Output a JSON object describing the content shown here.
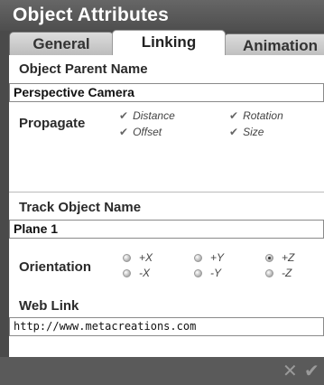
{
  "window": {
    "title": "Object Attributes"
  },
  "tabs": [
    {
      "label": "General",
      "active": false
    },
    {
      "label": "Linking",
      "active": true
    },
    {
      "label": "Animation",
      "active": false
    }
  ],
  "parent": {
    "label": "Object Parent Name",
    "value": "Perspective Camera"
  },
  "propagate": {
    "label": "Propagate",
    "options": [
      {
        "label": "Distance",
        "checked": true
      },
      {
        "label": "Rotation",
        "checked": true
      },
      {
        "label": "Offset",
        "checked": true
      },
      {
        "label": "Size",
        "checked": true
      }
    ]
  },
  "track": {
    "label": "Track Object Name",
    "value": "Plane 1"
  },
  "orientation": {
    "label": "Orientation",
    "options": [
      {
        "label": "+X",
        "selected": false
      },
      {
        "label": "+Y",
        "selected": false
      },
      {
        "label": "+Z",
        "selected": true
      },
      {
        "label": "-X",
        "selected": false
      },
      {
        "label": "-Y",
        "selected": false
      },
      {
        "label": "-Z",
        "selected": false
      }
    ]
  },
  "weblink": {
    "label": "Web Link",
    "value": "http://www.metacreations.com"
  },
  "footer": {
    "cancel_icon": "x-icon",
    "confirm_icon": "checkmark-icon"
  }
}
